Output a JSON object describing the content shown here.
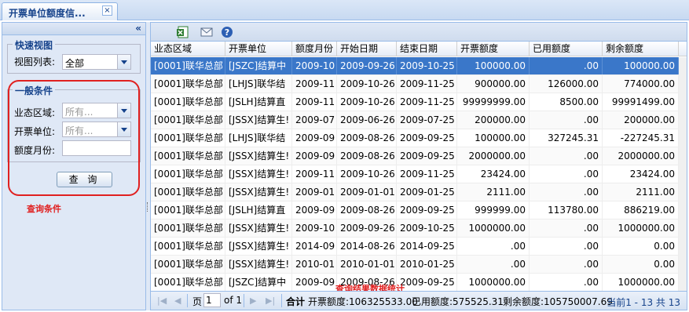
{
  "tab": {
    "title": "开票单位额度信...",
    "close": "×"
  },
  "left": {
    "collapse": "«",
    "quick_view": {
      "legend": "快速视图",
      "label": "视图列表:",
      "value": "全部"
    },
    "conditions": {
      "legend": "一般条件",
      "region_label": "业态区域:",
      "region_placeholder": "所有...",
      "unit_label": "开票单位:",
      "unit_placeholder": "所有...",
      "month_label": "额度月份:",
      "month_value": ""
    },
    "query_button": "查 询",
    "annotation": "查询条件"
  },
  "toolbar": {
    "icons": [
      "excel-export-icon",
      "mail-icon",
      "help-icon"
    ]
  },
  "grid": {
    "columns": [
      "业态区域",
      "开票单位",
      "额度月份",
      "开始日期",
      "结束日期",
      "开票额度",
      "已用额度",
      "剩余额度"
    ],
    "rows": [
      [
        "[0001]联华总部",
        "[JSZC]结算中",
        "2009-10",
        "2009-09-26",
        "2009-10-25",
        "100000.00",
        ".00",
        "100000.00"
      ],
      [
        "[0001]联华总部",
        "[LHJS]联华结",
        "2009-11",
        "2009-10-26",
        "2009-11-25",
        "900000.00",
        "126000.00",
        "774000.00"
      ],
      [
        "[0001]联华总部",
        "[JSLH]结算直",
        "2009-11",
        "2009-10-26",
        "2009-11-25",
        "99999999.00",
        "8500.00",
        "99991499.00"
      ],
      [
        "[0001]联华总部",
        "[JSSX]结算生!",
        "2009-07",
        "2009-06-26",
        "2009-07-25",
        "200000.00",
        ".00",
        "200000.00"
      ],
      [
        "[0001]联华总部",
        "[LHJS]联华结",
        "2009-09",
        "2009-08-26",
        "2009-09-25",
        "100000.00",
        "327245.31",
        "-227245.31"
      ],
      [
        "[0001]联华总部",
        "[JSSX]结算生!",
        "2009-09",
        "2009-08-26",
        "2009-09-25",
        "2000000.00",
        ".00",
        "2000000.00"
      ],
      [
        "[0001]联华总部",
        "[JSSX]结算生!",
        "2009-11",
        "2009-10-26",
        "2009-11-25",
        "23424.00",
        ".00",
        "23424.00"
      ],
      [
        "[0001]联华总部",
        "[JSSX]结算生!",
        "2009-01",
        "2009-01-01",
        "2009-01-25",
        "2111.00",
        ".00",
        "2111.00"
      ],
      [
        "[0001]联华总部",
        "[JSLH]结算直",
        "2009-09",
        "2009-08-26",
        "2009-09-25",
        "999999.00",
        "113780.00",
        "886219.00"
      ],
      [
        "[0001]联华总部",
        "[JSSX]结算生!",
        "2009-10",
        "2009-09-26",
        "2009-10-25",
        "1000000.00",
        ".00",
        "1000000.00"
      ],
      [
        "[0001]联华总部",
        "[JSSX]结算生!",
        "2014-09",
        "2014-08-26",
        "2014-09-25",
        ".00",
        ".00",
        "0.00"
      ],
      [
        "[0001]联华总部",
        "[JSSX]结算生!",
        "2010-01",
        "2010-01-01",
        "2010-01-25",
        ".00",
        ".00",
        "0.00"
      ],
      [
        "[0001]联华总部",
        "[JSZC]结算中",
        "2009-09",
        "2009-08-26",
        "2009-09-25",
        "1000000.00",
        ".00",
        "1000000.00"
      ]
    ],
    "selected_row": 0
  },
  "annotation_stats": "查询结果数据统计",
  "pager": {
    "page_label": "页",
    "page_value": "1",
    "of_label": "of 1",
    "total_label": "合计",
    "issued": "开票额度:106325533.00",
    "used": "已用额度:575525.31",
    "remaining": "剩余额度:105750007.69",
    "display": "当前1 - 13 共 13"
  },
  "colors": {
    "selected_row": "#3a77c9",
    "header_text": "#15428b",
    "annotation": "#e02020"
  }
}
